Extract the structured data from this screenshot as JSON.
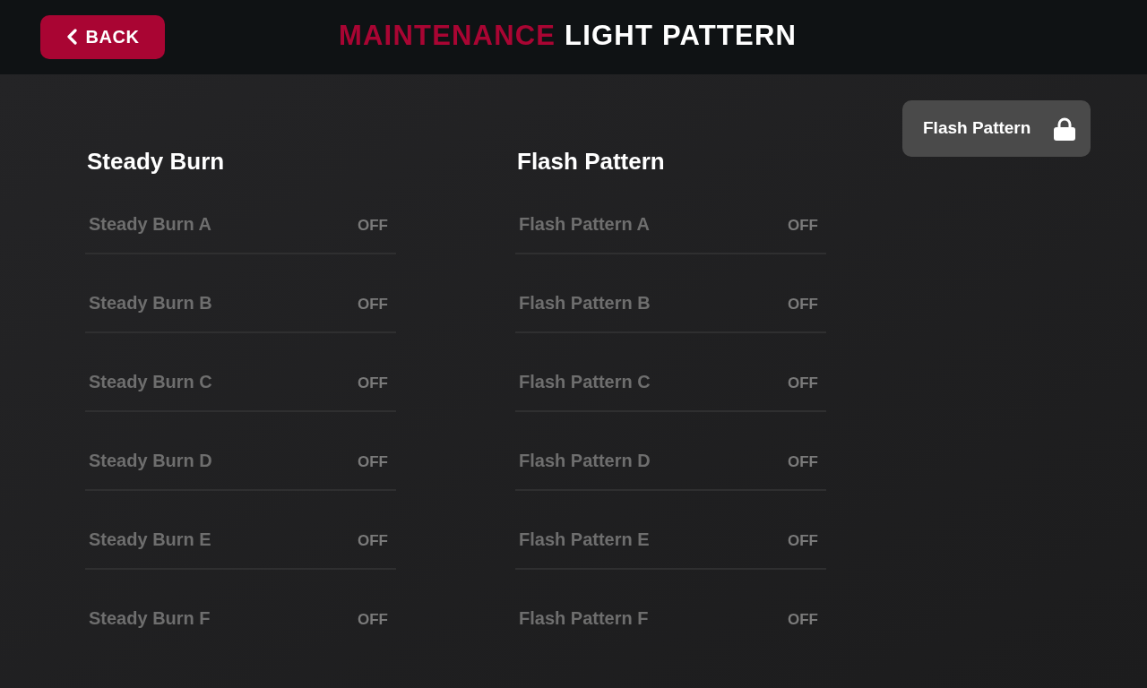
{
  "header": {
    "back_button": {
      "label": "BACK"
    },
    "title": {
      "accent": "MAINTENANCE",
      "text": "LIGHT PATTERN"
    }
  },
  "sections": [
    {
      "title": "Steady Burn",
      "rows": [
        {
          "label": "Steady Burn A",
          "status": "OFF",
          "disabled": true
        },
        {
          "label": "Steady Burn B",
          "status": "OFF",
          "disabled": true
        },
        {
          "label": "Steady Burn C",
          "status": "OFF",
          "disabled": true
        },
        {
          "label": "Steady Burn D",
          "status": "OFF",
          "disabled": true
        },
        {
          "label": "Steady Burn E",
          "status": "OFF",
          "disabled": true
        },
        {
          "label": "Steady Burn F",
          "status": "OFF",
          "disabled": true
        }
      ]
    },
    {
      "title": "Flash Pattern",
      "rows": [
        {
          "label": "Flash Pattern A",
          "status": "OFF",
          "disabled": true
        },
        {
          "label": "Flash Pattern B",
          "status": "OFF",
          "disabled": true
        },
        {
          "label": "Flash Pattern C",
          "status": "OFF",
          "disabled": true
        },
        {
          "label": "Flash Pattern D",
          "status": "OFF",
          "disabled": true
        },
        {
          "label": "Flash Pattern E",
          "status": "OFF",
          "disabled": true
        },
        {
          "label": "Flash Pattern F",
          "status": "OFF",
          "disabled": true
        }
      ]
    }
  ],
  "flash_pattern_button": {
    "label": "Flash Pattern",
    "locked": true
  }
}
